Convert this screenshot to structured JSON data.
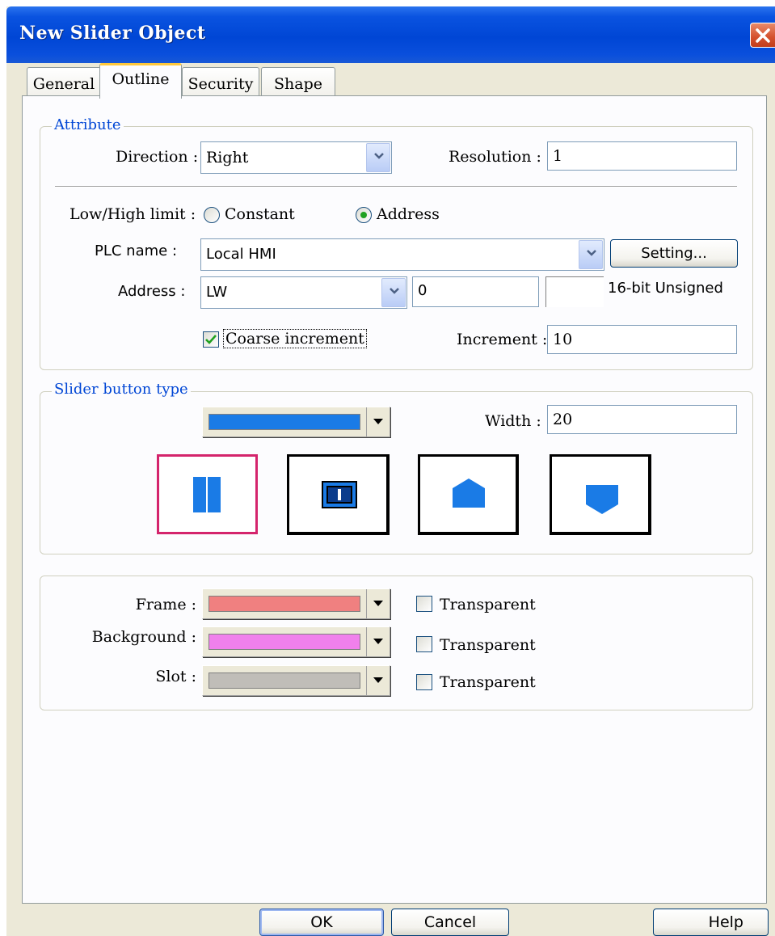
{
  "window": {
    "title": "New  Slider Object"
  },
  "tabs": [
    {
      "label": "General",
      "active": false
    },
    {
      "label": "Outline",
      "active": true
    },
    {
      "label": "Security",
      "active": false
    },
    {
      "label": "Shape",
      "active": false
    }
  ],
  "attribute": {
    "legend": "Attribute",
    "direction_label": "Direction :",
    "direction_value": "Right",
    "resolution_label": "Resolution :",
    "resolution_value": "1",
    "limit_label": "Low/High limit :",
    "limit_options": [
      {
        "label": "Constant",
        "checked": false
      },
      {
        "label": "Address",
        "checked": true
      }
    ],
    "plc_label": "PLC name :",
    "plc_value": "Local HMI",
    "setting_button": "Setting...",
    "address_label": "Address :",
    "address_device": "LW",
    "address_value": "0",
    "address_extra": "",
    "data_format": "16-bit Unsigned",
    "coarse_label": "Coarse increment",
    "coarse_checked": true,
    "increment_label": "Increment :",
    "increment_value": "10"
  },
  "slider_button": {
    "legend": "Slider button type",
    "color": "#1a7be6",
    "width_label": "Width :",
    "width_value": "20",
    "shapes": [
      {
        "name": "split-bar",
        "selected": true
      },
      {
        "name": "framed-bar",
        "selected": false
      },
      {
        "name": "pentagon-up",
        "selected": false
      },
      {
        "name": "pentagon-down",
        "selected": false
      }
    ]
  },
  "colors": {
    "frame_label": "Frame :",
    "frame_color": "#f08080",
    "background_label": "Background :",
    "background_color": "#f080ec",
    "slot_label": "Slot :",
    "slot_color": "#c0bdb8",
    "transparent_label": "Transparent"
  },
  "buttons": {
    "ok": "OK",
    "cancel": "Cancel",
    "help": "Help"
  }
}
